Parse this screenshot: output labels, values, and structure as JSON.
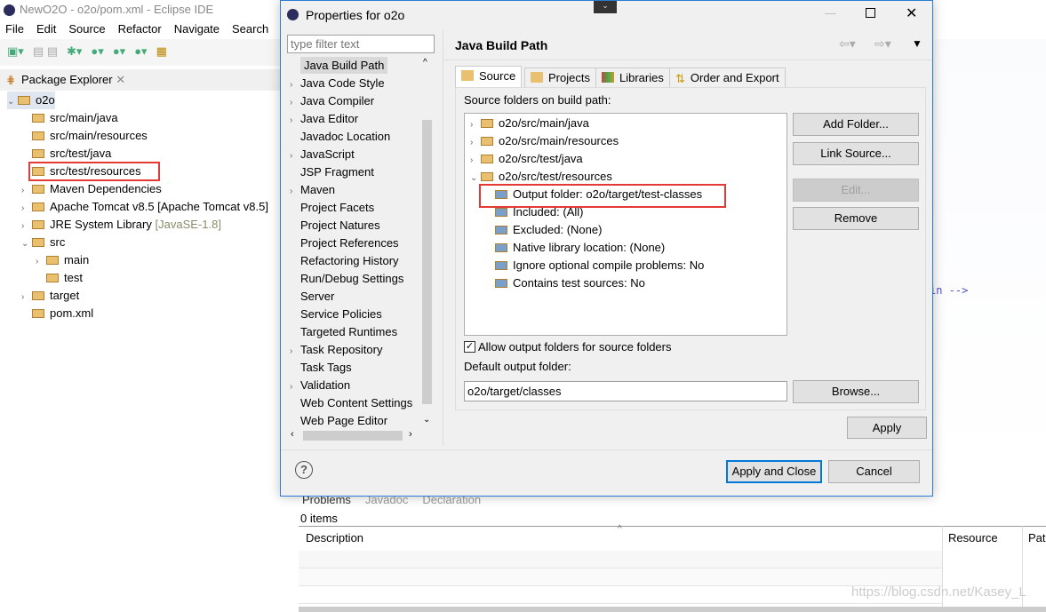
{
  "window": {
    "title": "NewO2O - o2o/pom.xml - Eclipse IDE"
  },
  "menu": [
    "File",
    "Edit",
    "Source",
    "Refactor",
    "Navigate",
    "Search",
    "R"
  ],
  "package_explorer": {
    "title": "Package Explorer",
    "items": [
      {
        "label": "o2o",
        "depth": 0,
        "chev": "⌄"
      },
      {
        "label": "src/main/java",
        "depth": 1,
        "chev": ""
      },
      {
        "label": "src/main/resources",
        "depth": 1,
        "chev": ""
      },
      {
        "label": "src/test/java",
        "depth": 1,
        "chev": ""
      },
      {
        "label": "src/test/resources",
        "depth": 1,
        "chev": "",
        "highlighted": true
      },
      {
        "label": "Maven Dependencies",
        "depth": 1,
        "chev": "›"
      },
      {
        "label": "Apache Tomcat v8.5 [Apache Tomcat v8.5]",
        "depth": 1,
        "chev": "›"
      },
      {
        "label": "JRE System Library",
        "suffix": "[JavaSE-1.8]",
        "depth": 1,
        "chev": "›"
      },
      {
        "label": "src",
        "depth": 1,
        "chev": "⌄"
      },
      {
        "label": "main",
        "depth": 2,
        "chev": "›"
      },
      {
        "label": "test",
        "depth": 2,
        "chev": ""
      },
      {
        "label": "target",
        "depth": 1,
        "chev": "›"
      },
      {
        "label": "pom.xml",
        "depth": 1,
        "chev": ""
      }
    ]
  },
  "editor": {
    "fragment": "in -->"
  },
  "problems": {
    "tabs": [
      "Problems",
      "Javadoc",
      "Declaration"
    ],
    "count": "0 items",
    "columns": [
      "Description",
      "Resource",
      "Path"
    ],
    "watermark": "https://blog.csdn.net/Kasey_L"
  },
  "dialog": {
    "title": "Properties for o2o",
    "filter_placeholder": "type filter text",
    "nav": [
      {
        "label": "Java Build Path",
        "chev": "",
        "selected": true
      },
      {
        "label": "Java Code Style",
        "chev": "›"
      },
      {
        "label": "Java Compiler",
        "chev": "›"
      },
      {
        "label": "Java Editor",
        "chev": "›"
      },
      {
        "label": "Javadoc Location",
        "chev": ""
      },
      {
        "label": "JavaScript",
        "chev": "›"
      },
      {
        "label": "JSP Fragment",
        "chev": ""
      },
      {
        "label": "Maven",
        "chev": "›"
      },
      {
        "label": "Project Facets",
        "chev": ""
      },
      {
        "label": "Project Natures",
        "chev": ""
      },
      {
        "label": "Project References",
        "chev": ""
      },
      {
        "label": "Refactoring History",
        "chev": ""
      },
      {
        "label": "Run/Debug Settings",
        "chev": ""
      },
      {
        "label": "Server",
        "chev": ""
      },
      {
        "label": "Service Policies",
        "chev": ""
      },
      {
        "label": "Targeted Runtimes",
        "chev": ""
      },
      {
        "label": "Task Repository",
        "chev": "›"
      },
      {
        "label": "Task Tags",
        "chev": ""
      },
      {
        "label": "Validation",
        "chev": "›"
      },
      {
        "label": "Web Content Settings",
        "chev": ""
      },
      {
        "label": "Web Page Editor",
        "chev": ""
      }
    ],
    "page_title": "Java Build Path",
    "tabs": [
      "Source",
      "Projects",
      "Libraries",
      "Order and Export"
    ],
    "source_label": "Source folders on build path:",
    "source_tree": [
      {
        "label": "o2o/src/main/java",
        "depth": 0,
        "chev": "›"
      },
      {
        "label": "o2o/src/main/resources",
        "depth": 0,
        "chev": "›"
      },
      {
        "label": "o2o/src/test/java",
        "depth": 0,
        "chev": "›"
      },
      {
        "label": "o2o/src/test/resources",
        "depth": 0,
        "chev": "⌄"
      },
      {
        "label": "Output folder: o2o/target/test-classes",
        "depth": 1,
        "chev": "",
        "highlighted": true
      },
      {
        "label": "Included: (All)",
        "depth": 1,
        "chev": ""
      },
      {
        "label": "Excluded: (None)",
        "depth": 1,
        "chev": ""
      },
      {
        "label": "Native library location: (None)",
        "depth": 1,
        "chev": ""
      },
      {
        "label": "Ignore optional compile problems: No",
        "depth": 1,
        "chev": ""
      },
      {
        "label": "Contains test sources: No",
        "depth": 1,
        "chev": ""
      }
    ],
    "buttons": {
      "add_folder": "Add Folder...",
      "link_source": "Link Source...",
      "edit": "Edit...",
      "remove": "Remove",
      "browse": "Browse...",
      "apply": "Apply",
      "apply_close": "Apply and Close",
      "cancel": "Cancel"
    },
    "allow_output_label": "Allow output folders for source folders",
    "allow_output_checked": true,
    "default_output_label": "Default output folder:",
    "default_output_value": "o2o/target/classes"
  }
}
